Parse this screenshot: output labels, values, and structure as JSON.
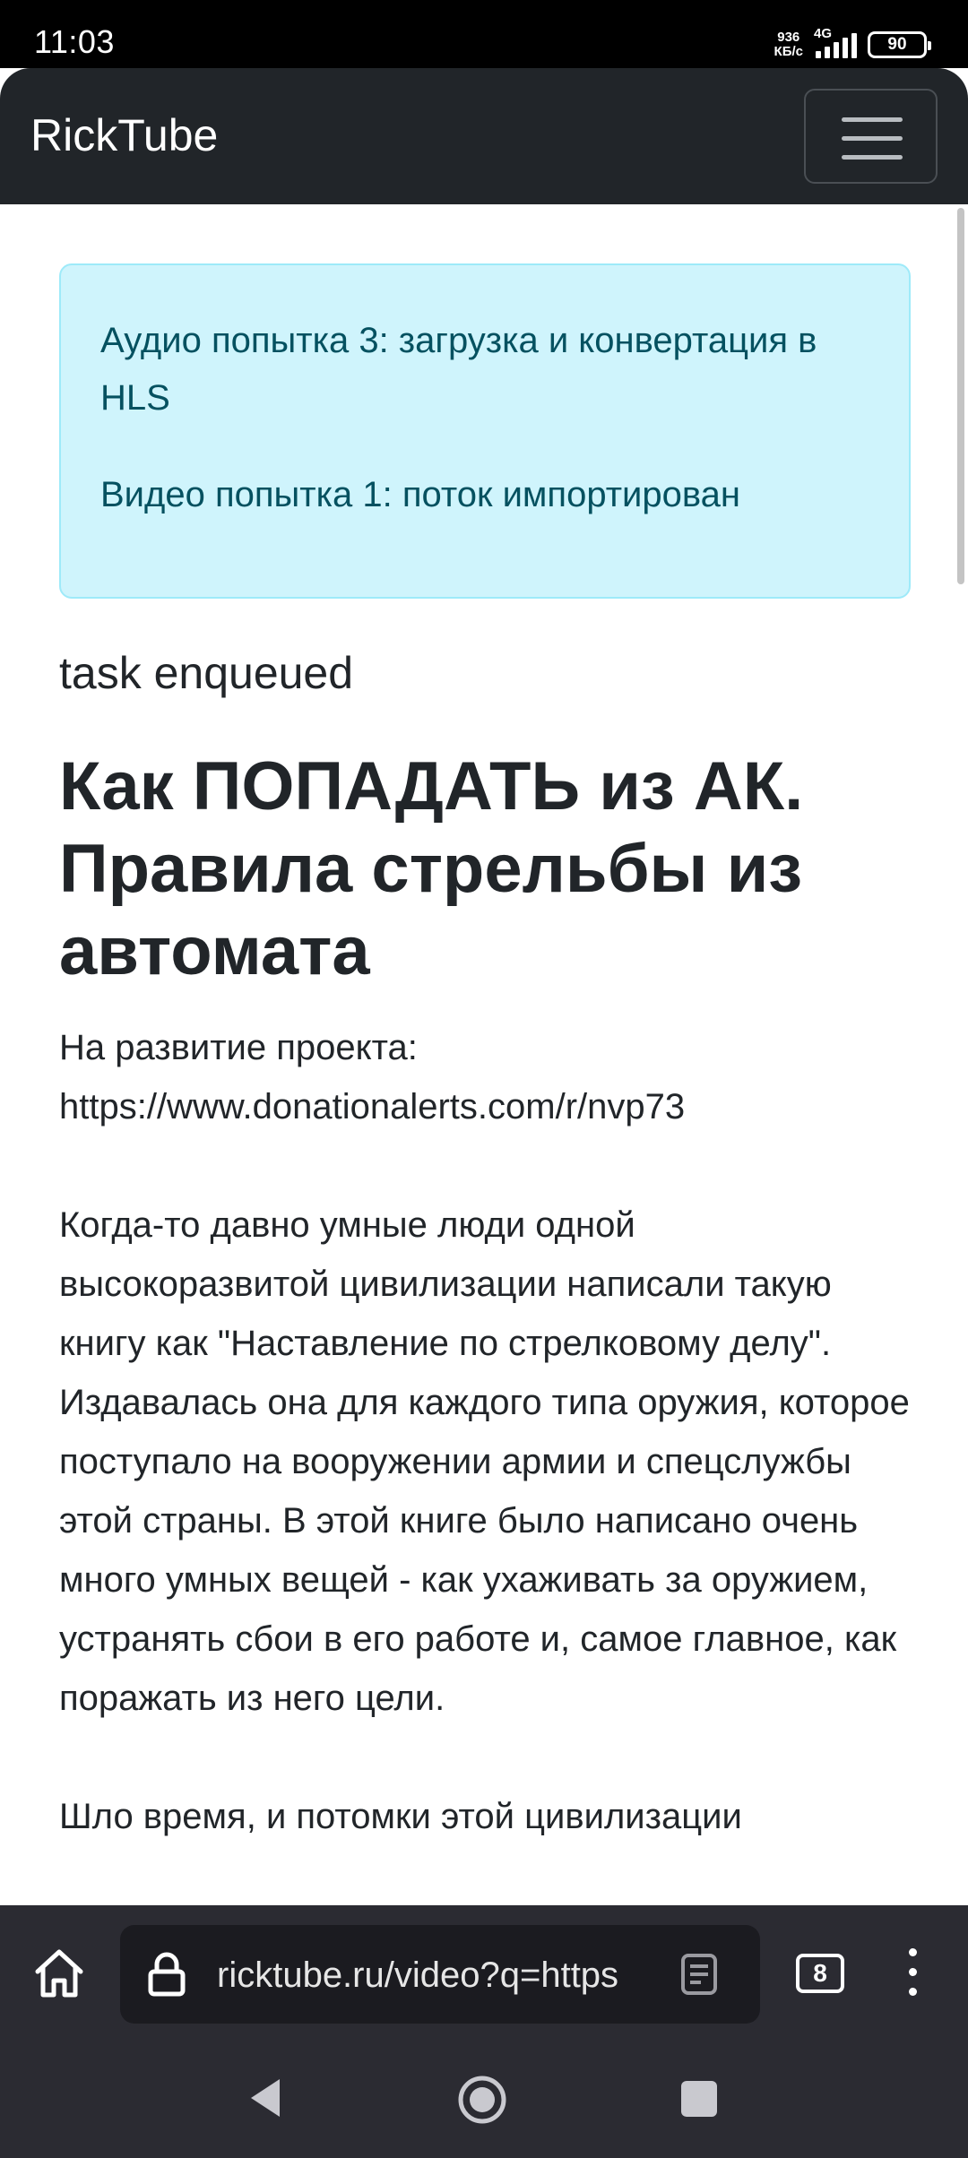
{
  "status_bar": {
    "time": "11:03",
    "net_speed_value": "936",
    "net_speed_unit": "КБ/с",
    "network": "4G",
    "battery": "90"
  },
  "navbar": {
    "brand": "RickTube",
    "menu_icon": "hamburger-icon"
  },
  "alert": {
    "lines": [
      "Аудио попытка 3: загрузка и конвертация в HLS",
      "Видео попытка 1: поток импортирован"
    ]
  },
  "status_text": "task enqueued",
  "video": {
    "title": "Как ПОПАДАТЬ из АК. Правила стрельбы из автомата",
    "description": [
      "На развитие проекта: https://www.donationalerts.com/r/nvp73",
      "Когда-то давно умные люди одной высокоразвитой цивилизации написали такую книгу как \"Наставление по стрелковому делу\". Издавалась она для каждого типа оружия, которое поступало на вооружении армии и спецслужбы этой страны. В этой книге было написано очень много умных вещей - как ухаживать за оружием, устранять сбои в его работе и, самое главное, как поражать из него цели.",
      "Шло время, и потомки этой цивилизации"
    ]
  },
  "browser": {
    "url": "ricktube.ru/video?q=https",
    "tab_count": "8",
    "icons": [
      "home-icon",
      "lock-icon",
      "reader-mode-icon",
      "tabs-icon",
      "more-vert-icon"
    ]
  },
  "system_nav": {
    "icons": [
      "back-icon",
      "home-circle-icon",
      "recents-icon"
    ]
  },
  "colors": {
    "navbar_bg": "#212529",
    "alert_bg": "#cff4fc",
    "alert_border": "#9eeaf9",
    "alert_text": "#055160",
    "browser_bar_bg": "#2b2b32"
  }
}
